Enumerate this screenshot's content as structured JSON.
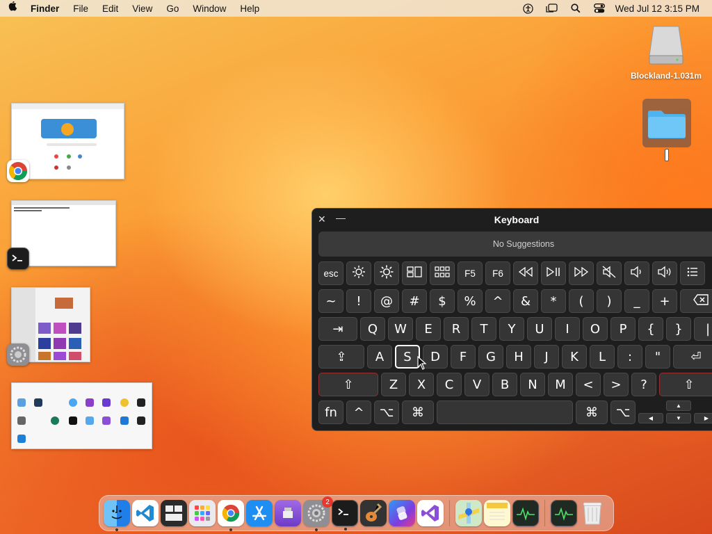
{
  "menubar": {
    "app_name": "Finder",
    "menus": [
      "File",
      "Edit",
      "View",
      "Go",
      "Window",
      "Help"
    ],
    "clock": "Wed Jul 12  3:15 PM"
  },
  "desktop": {
    "drive_label": "Blockland-1.031m"
  },
  "keyboard_viewer": {
    "title": "Keyboard",
    "suggestions": "No Suggestions",
    "rows": [
      [
        "esc",
        "☼",
        "☀",
        "⧉",
        "▦",
        "F5",
        "F6",
        "⏪",
        "⏯",
        "⏩",
        "🔇",
        "🔉",
        "🔊",
        "☰"
      ],
      [
        "~",
        "!",
        "@",
        "#",
        "$",
        "%",
        "^",
        "&",
        "*",
        "(",
        ")",
        "_",
        "+",
        "⌫"
      ],
      [
        "⇥",
        "Q",
        "W",
        "E",
        "R",
        "T",
        "Y",
        "U",
        "I",
        "O",
        "P",
        "{",
        "}",
        "|"
      ],
      [
        "⇪",
        "A",
        "S",
        "D",
        "F",
        "G",
        "H",
        "J",
        "K",
        "L",
        ":",
        "\"",
        "⏎"
      ],
      [
        "⇧",
        "Z",
        "X",
        "C",
        "V",
        "B",
        "N",
        "M",
        "<",
        ">",
        "?",
        "⇧"
      ],
      [
        "fn",
        "^",
        "⌥",
        "⌘",
        "",
        "⌘",
        "⌥"
      ]
    ],
    "selected_key": "S"
  },
  "dock": {
    "apps": [
      {
        "name": "Finder",
        "icon": "finder-icon",
        "color": "#3aa0f3",
        "running": true
      },
      {
        "name": "Visual Studio Code",
        "icon": "vscode-icon",
        "color": "#ffffff",
        "running": false
      },
      {
        "name": "Mission Control",
        "icon": "mission-control-icon",
        "color": "#2b2b2b",
        "running": false
      },
      {
        "name": "Launchpad",
        "icon": "launchpad-icon",
        "color": "#e9e9ee",
        "running": false
      },
      {
        "name": "Google Chrome",
        "icon": "chrome-icon",
        "color": "#ffffff",
        "running": true
      },
      {
        "name": "App Store",
        "icon": "app-store-icon",
        "color": "#1e8ef3",
        "running": false
      },
      {
        "name": "Podcasts",
        "icon": "podcasts-icon",
        "color": "#8f55d8",
        "running": false
      },
      {
        "name": "System Settings",
        "icon": "settings-icon",
        "color": "#8e8e93",
        "running": true,
        "badge": "2"
      },
      {
        "name": "Terminal",
        "icon": "terminal-icon",
        "color": "#222222",
        "running": true
      },
      {
        "name": "GarageBand",
        "icon": "garageband-icon",
        "color": "#333333",
        "running": false
      },
      {
        "name": "Shortcuts",
        "icon": "shortcuts-icon",
        "color": "#4a4ad8",
        "running": false
      },
      {
        "name": "Visual Studio",
        "icon": "visual-studio-icon",
        "color": "#ffffff",
        "running": false
      },
      {
        "name": "Maps",
        "icon": "maps-icon",
        "color": "#8fd48f",
        "running": false
      },
      {
        "name": "Notes",
        "icon": "notes-icon",
        "color": "#fff6c8",
        "running": false
      },
      {
        "name": "Activity Monitor",
        "icon": "activity-monitor-icon",
        "color": "#1f2a22",
        "running": false
      },
      {
        "name": "Activity Monitor",
        "icon": "activity-monitor-icon",
        "color": "#1f2a22",
        "running": false
      },
      {
        "name": "Trash",
        "icon": "trash-icon",
        "color": "#e8e8e8",
        "running": false
      }
    ]
  }
}
